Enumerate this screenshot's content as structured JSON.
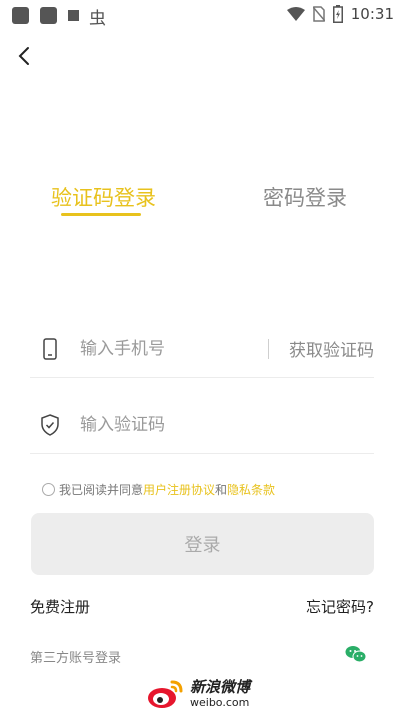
{
  "status_bar": {
    "time": "10:31",
    "left_icons": [
      "app-notification-icon",
      "app-notification-icon",
      "small-square-icon",
      "bug-icon"
    ],
    "right_icons": [
      "wifi-icon",
      "no-sim-icon",
      "battery-icon"
    ]
  },
  "header": {
    "back_icon": "chevron-left-icon"
  },
  "tabs": [
    {
      "label": "验证码登录",
      "active": true
    },
    {
      "label": "密码登录",
      "active": false
    }
  ],
  "phone_field": {
    "placeholder": "输入手机号",
    "value": "",
    "icon": "phone-icon"
  },
  "get_code_label": "获取验证码",
  "code_field": {
    "placeholder": "输入验证码",
    "value": "",
    "icon": "shield-icon"
  },
  "agreement": {
    "prefix": "我已阅读并同意",
    "user_agreement": "用户注册协议",
    "and": "和",
    "privacy_policy": "隐私条款",
    "checked": false
  },
  "login_button": "登录",
  "register_link": "免费注册",
  "forgot_password": "忘记密码?",
  "third_party_label": "第三方账号登录",
  "third_party_icons": [
    "wechat-icon"
  ],
  "weibo": {
    "name_cn": "新浪微博",
    "name_en": "weibo.com",
    "icon": "weibo-logo-icon"
  },
  "colors": {
    "accent": "#e8c21d",
    "button_bg": "#ededed",
    "button_text": "#aaaaaa"
  }
}
